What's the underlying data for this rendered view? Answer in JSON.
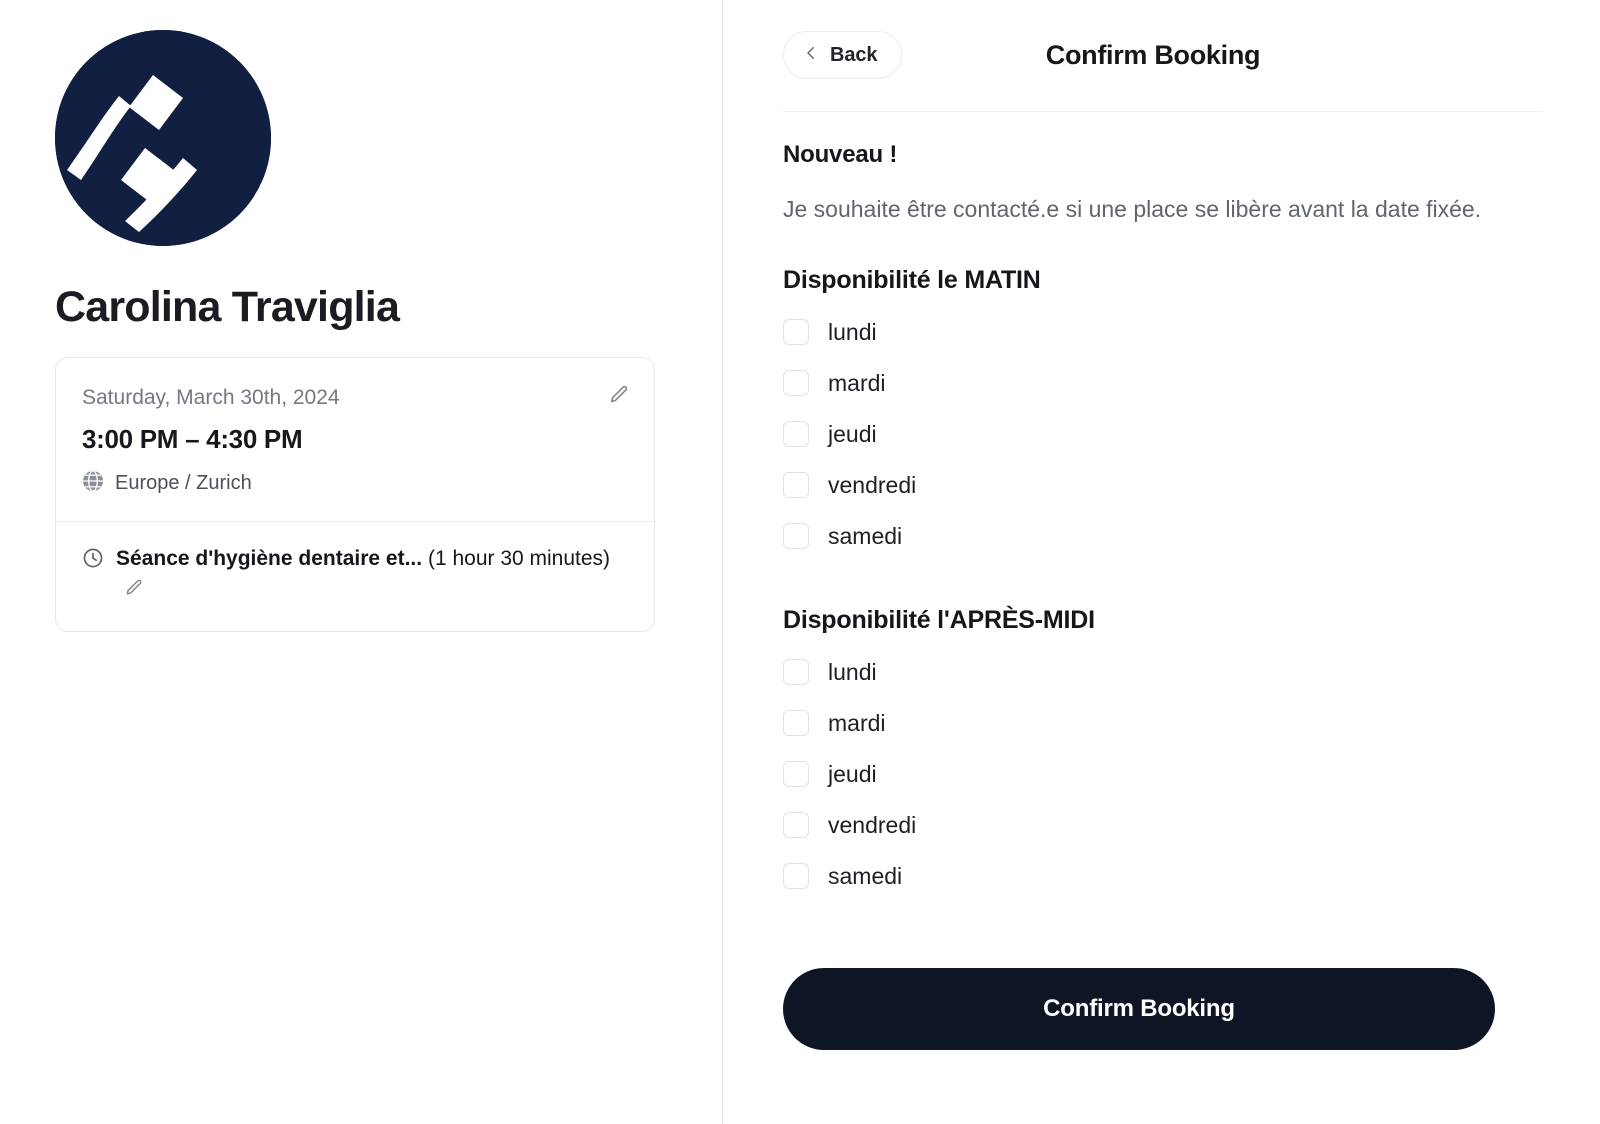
{
  "left": {
    "logo_icon": "toothbrush-circle-logo",
    "logo_color": "#111f40",
    "profile_name": "Carolina Traviglia",
    "booking_card": {
      "date": "Saturday, March 30th, 2024",
      "time_range": "3:00 PM – 4:30 PM",
      "timezone_icon": "globe-icon",
      "timezone": "Europe / Zurich",
      "edit_date_icon": "pencil-icon",
      "event_icon": "clock-icon",
      "event_title": "Séance d'hygiène dentaire et...",
      "event_duration": "(1 hour 30 minutes)",
      "edit_event_icon": "pencil-icon"
    }
  },
  "right": {
    "back_button": {
      "icon": "chevron-left-icon",
      "label": "Back"
    },
    "title": "Confirm Booking",
    "new_heading": "Nouveau !",
    "intro_paragraph": "Je souhaite être contacté.e si une place se libère avant la date fixée.",
    "morning": {
      "heading": "Disponibilité le MATIN",
      "days": [
        {
          "label": "lundi",
          "checked": false
        },
        {
          "label": "mardi",
          "checked": false
        },
        {
          "label": "jeudi",
          "checked": false
        },
        {
          "label": "vendredi",
          "checked": false
        },
        {
          "label": "samedi",
          "checked": false
        }
      ]
    },
    "afternoon": {
      "heading": "Disponibilité l'APRÈS-MIDI",
      "days": [
        {
          "label": "lundi",
          "checked": false
        },
        {
          "label": "mardi",
          "checked": false
        },
        {
          "label": "jeudi",
          "checked": false
        },
        {
          "label": "vendredi",
          "checked": false
        },
        {
          "label": "samedi",
          "checked": false
        }
      ]
    },
    "confirm_button_label": "Confirm Booking",
    "confirm_button_color": "#0e1626"
  }
}
